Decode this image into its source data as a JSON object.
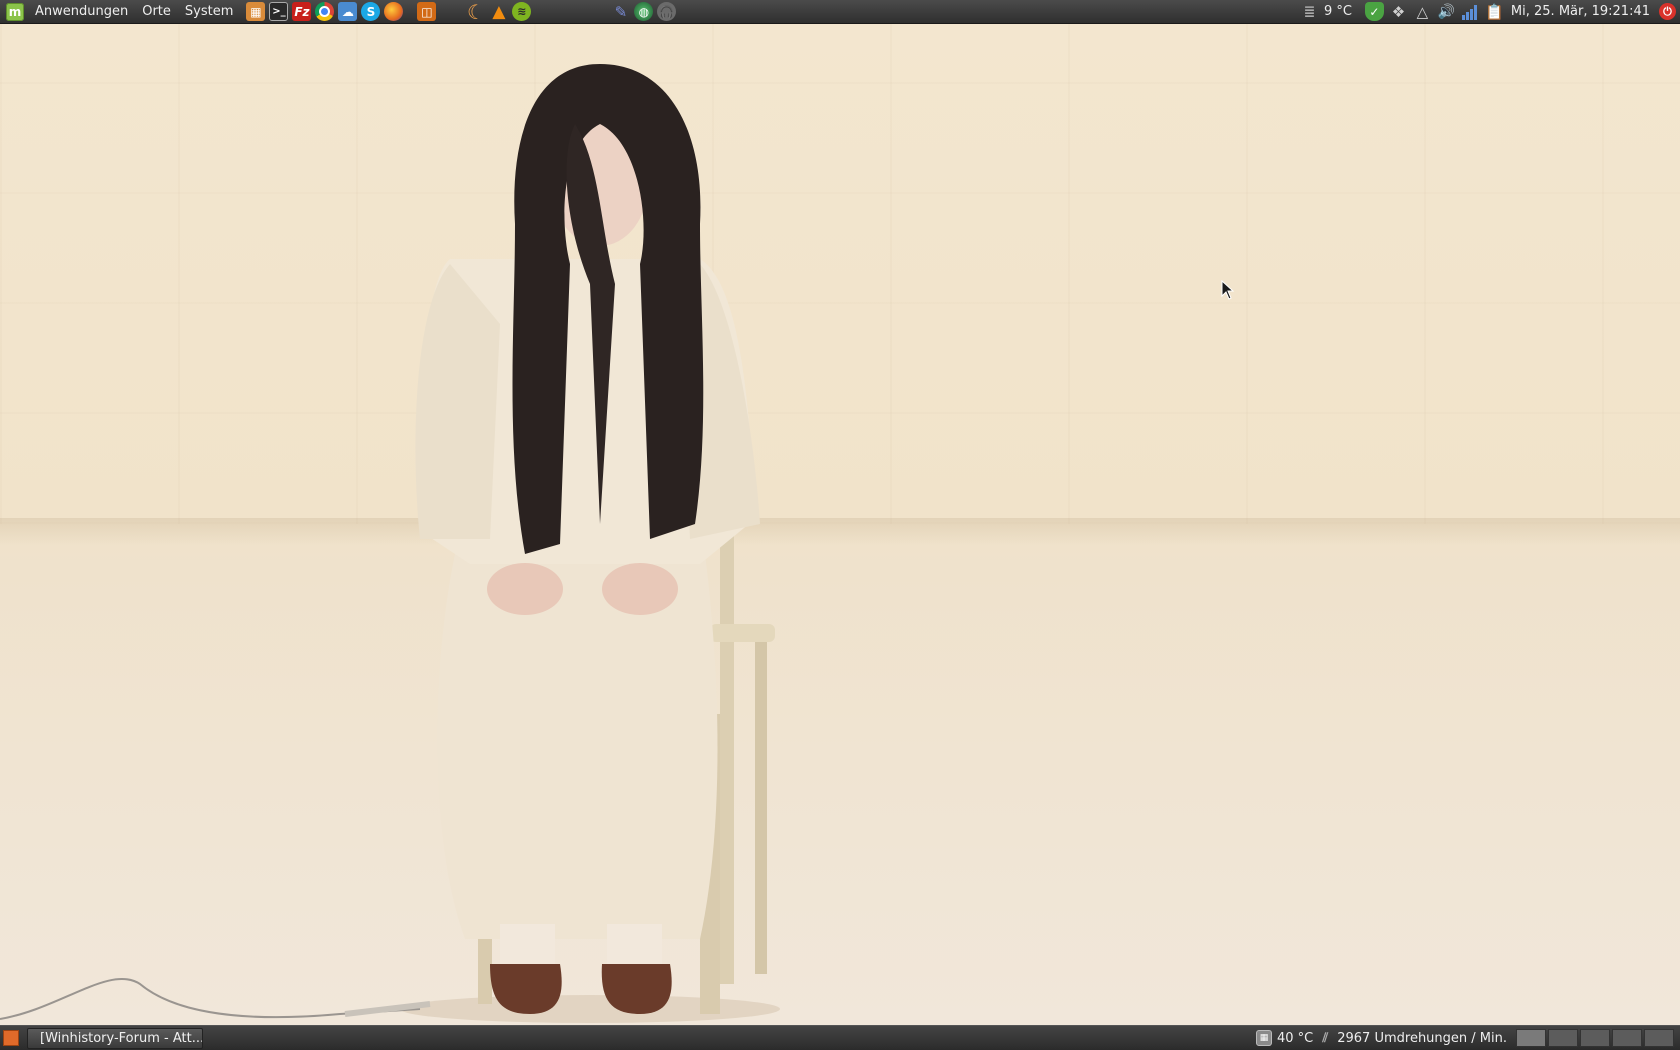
{
  "top_panel": {
    "menus": [
      {
        "name": "menu-anwendungen",
        "label": "Anwendungen"
      },
      {
        "name": "menu-orte",
        "label": "Orte"
      },
      {
        "name": "menu-system",
        "label": "System"
      }
    ],
    "launchers": [
      {
        "icon": "calculator-icon",
        "color": "#d98b3a"
      },
      {
        "icon": "terminal-icon",
        "color": "#2a2a2a"
      },
      {
        "icon": "filezilla-icon",
        "color": "#c8201b"
      },
      {
        "icon": "chrome-icon",
        "color": "#3f8cde"
      },
      {
        "icon": "cloud-sync-icon",
        "color": "#4a8bd0"
      },
      {
        "icon": "skype-icon",
        "color": "#1ba8e6"
      },
      {
        "icon": "firefox-icon",
        "color": "#e66a1e"
      },
      {
        "icon": "remote-desktop-icon",
        "color": "#d26a16"
      }
    ],
    "launchers_2": [
      {
        "icon": "banana-icon",
        "color": "#f2a24a"
      },
      {
        "icon": "vlc-icon",
        "color": "#f28c0f"
      },
      {
        "icon": "spotify-icon",
        "color": "#7fb520"
      }
    ],
    "launchers_3": [
      {
        "icon": "pen-tool-icon",
        "color": "#4b5fb3"
      },
      {
        "icon": "globe-icon",
        "color": "#2d7d44"
      },
      {
        "icon": "headphones-icon",
        "color": "#6b6b6b"
      }
    ],
    "weather": "9 °C",
    "tray_icons": [
      {
        "icon": "shield-icon",
        "color": "#4aa342"
      },
      {
        "icon": "dropbox-icon",
        "color": "#bbbbbb"
      },
      {
        "icon": "drive-icon",
        "color": "#bbbbbb"
      },
      {
        "icon": "volume-icon",
        "color": "#bbbbbb"
      },
      {
        "icon": "network-signal-icon",
        "color": "#5b8fd9"
      },
      {
        "icon": "clipboard-icon",
        "color": "#cfcfcf"
      }
    ],
    "clock": "Mi, 25. Mär, 19:21:41",
    "power_color": "#d9322b"
  },
  "bottom_panel": {
    "task_title": "[Winhistory-Forum - Att...",
    "cpu_temp": "40 °C",
    "fan_speed": "2967 Umdrehungen / Min."
  }
}
